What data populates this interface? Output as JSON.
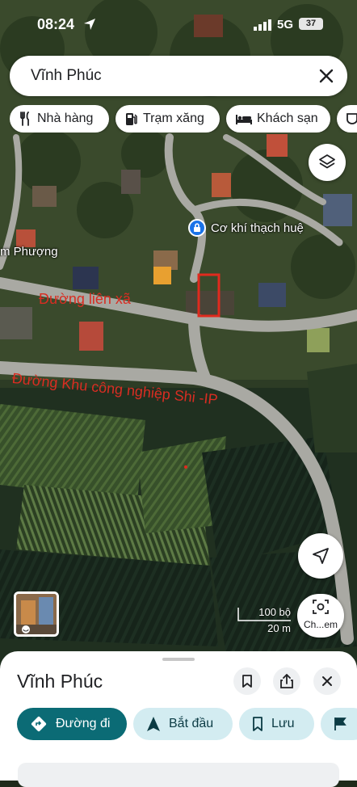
{
  "status_bar": {
    "time": "08:24",
    "network": "5G",
    "battery": "37"
  },
  "search": {
    "query": "Vĩnh Phúc"
  },
  "chips": [
    {
      "label": "Nhà hàng",
      "icon": "fork-knife-icon"
    },
    {
      "label": "Trạm xăng",
      "icon": "gas-station-icon"
    },
    {
      "label": "Khách sạn",
      "icon": "bed-icon"
    },
    {
      "label": "",
      "icon": "coffee-icon"
    }
  ],
  "map": {
    "poi_name": "Cơ khí thạch huệ",
    "place_label": "m Phượng",
    "road_annotation_1": "Đường liên xã",
    "road_annotation_2": "Đường Khu công nghiệp Shi -IP",
    "scale_top": "100 bộ",
    "scale_bottom": "20 m",
    "lens_label": "Ch...em",
    "annotation_color": "#d92d22"
  },
  "sheet": {
    "title": "Vĩnh Phúc",
    "actions": [
      {
        "label": "Đường đi",
        "icon": "directions-icon"
      },
      {
        "label": "Bắt đầu",
        "icon": "navigation-arrow-icon"
      },
      {
        "label": "Lưu",
        "icon": "bookmark-icon"
      },
      {
        "label": "",
        "icon": "flag-icon"
      }
    ]
  },
  "colors": {
    "primary_button": "#0b6b75",
    "tonal_button": "#d3ecf1",
    "pin": "#1a73e8"
  }
}
